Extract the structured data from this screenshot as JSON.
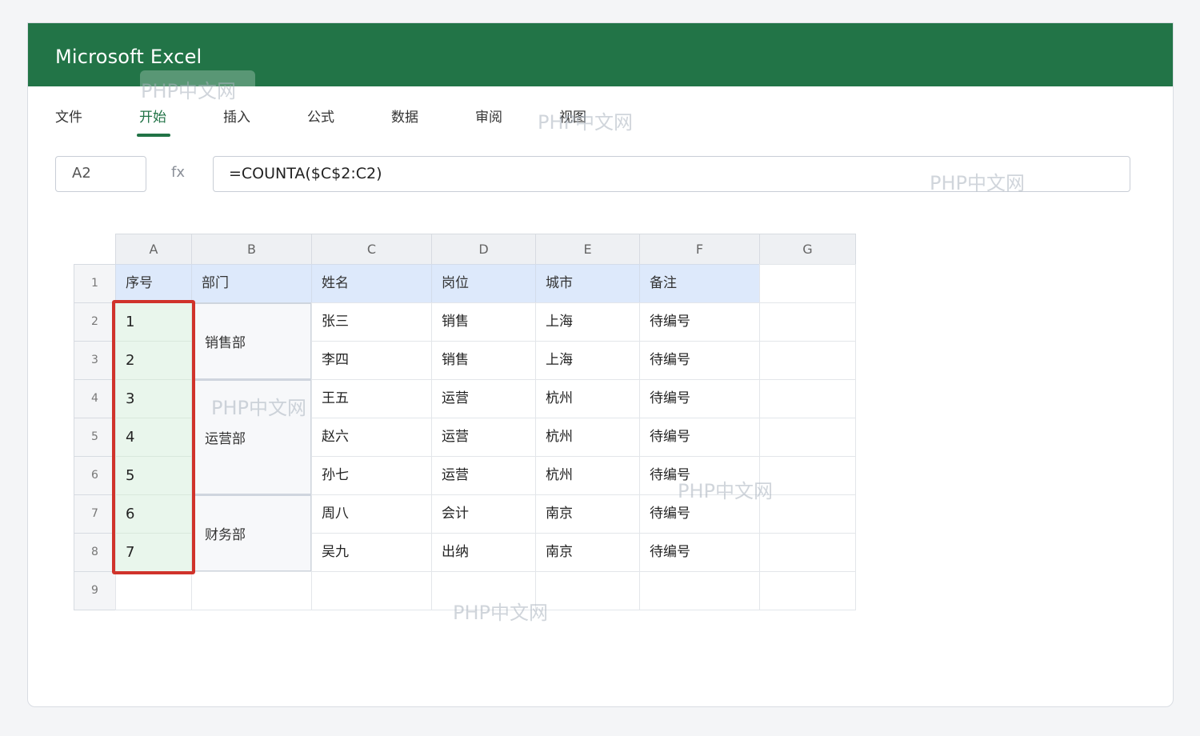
{
  "app": {
    "title": "Microsoft Excel"
  },
  "menu": {
    "tabs": [
      {
        "label": "文件"
      },
      {
        "label": "开始"
      },
      {
        "label": "插入"
      },
      {
        "label": "公式"
      },
      {
        "label": "数据"
      },
      {
        "label": "审阅"
      },
      {
        "label": "视图"
      }
    ],
    "active_tab": "开始"
  },
  "formula_bar": {
    "name_box": "A2",
    "fx_label": "fx",
    "formula": "=COUNTA($C$2:C2)"
  },
  "sheet": {
    "columns": [
      "A",
      "B",
      "C",
      "D",
      "E",
      "F",
      "G"
    ],
    "rows": [
      "1",
      "2",
      "3",
      "4",
      "5",
      "6",
      "7",
      "8",
      "9"
    ],
    "header_row": [
      "序号",
      "部门",
      "姓名",
      "岗位",
      "城市",
      "备注"
    ],
    "seq": [
      "1",
      "2",
      "3",
      "4",
      "5",
      "6",
      "7"
    ],
    "departments": [
      "销售部",
      "运营部",
      "财务部"
    ],
    "names": [
      "张三",
      "李四",
      "王五",
      "赵六",
      "孙七",
      "周八",
      "吴九"
    ],
    "positions": [
      "销售",
      "销售",
      "运营",
      "运营",
      "运营",
      "会计",
      "出纳"
    ],
    "cities": [
      "上海",
      "上海",
      "杭州",
      "杭州",
      "杭州",
      "南京",
      "南京"
    ],
    "notes": [
      "待编号",
      "待编号",
      "待编号",
      "待编号",
      "待编号",
      "待编号",
      "待编号"
    ],
    "selection_range": "A2:A8"
  },
  "watermark": "PHP中文网",
  "colors": {
    "titlebar": "#227447",
    "accent": "#217346",
    "selection": "#d0332b",
    "header_fill": "#dde9fb",
    "seq_fill": "#e9f6ec"
  }
}
